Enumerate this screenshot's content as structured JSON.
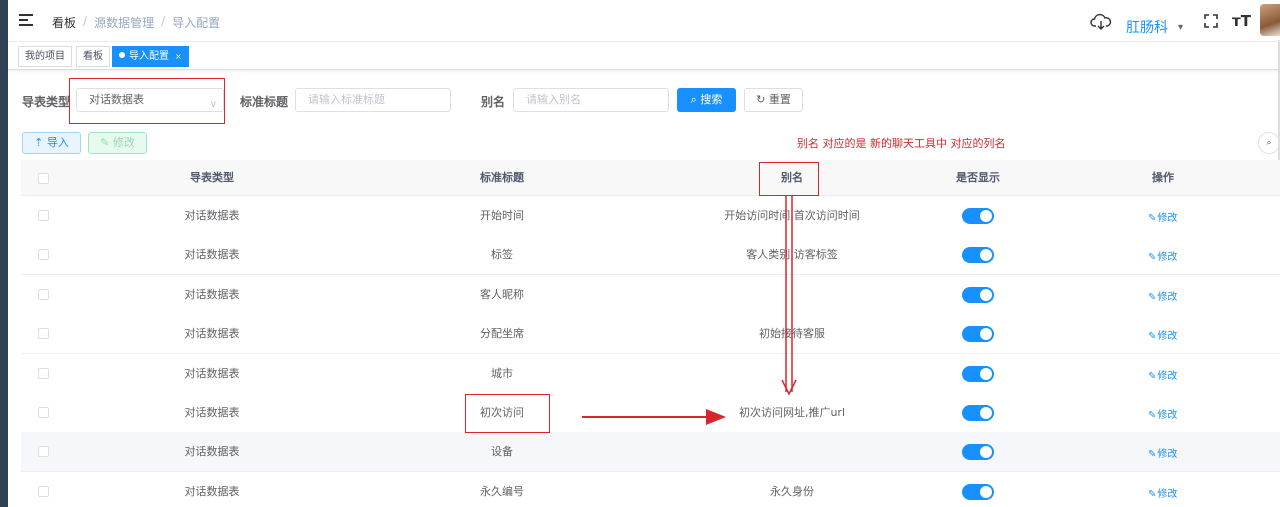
{
  "breadcrumb": {
    "items": [
      "看板",
      "源数据管理",
      "导入配置"
    ],
    "separator": "/"
  },
  "header": {
    "username": "肛肠科",
    "size_icon_text": "тT"
  },
  "tags": [
    {
      "label": "我的项目"
    },
    {
      "label": "看板"
    },
    {
      "label": "导入配置",
      "active": true,
      "close": "×"
    }
  ],
  "search": {
    "type_label": "导表类型",
    "type_value": "对话数据表",
    "title_label": "标准标题",
    "title_placeholder": "请输入标准标题",
    "alias_label": "别名",
    "alias_placeholder": "请输入别名",
    "search_button": "搜索",
    "reset_button": "重置"
  },
  "toolbar": {
    "import_button": "导入",
    "edit_button": "修改"
  },
  "annotation": {
    "note": "别名  对应的是 新的聊天工具中  对应的列名"
  },
  "table": {
    "columns": [
      "导表类型",
      "标准标题",
      "别名",
      "是否显示",
      "操作"
    ],
    "rows": [
      {
        "type": "对话数据表",
        "title": "开始时间",
        "alias": "开始访问时间,首次访问时间",
        "shown": true,
        "action": "修改"
      },
      {
        "type": "对话数据表",
        "title": "标签",
        "alias": "客人类别,访客标签",
        "shown": true,
        "action": "修改"
      },
      {
        "type": "对话数据表",
        "title": "客人昵称",
        "alias": "",
        "shown": true,
        "action": "修改"
      },
      {
        "type": "对话数据表",
        "title": "分配坐席",
        "alias": "初始接待客服",
        "shown": true,
        "action": "修改"
      },
      {
        "type": "对话数据表",
        "title": "城市",
        "alias": "",
        "shown": true,
        "action": "修改"
      },
      {
        "type": "对话数据表",
        "title": "初次访问",
        "alias": "初次访问网址,推广url",
        "shown": true,
        "action": "修改"
      },
      {
        "type": "对话数据表",
        "title": "设备",
        "alias": "",
        "shown": true,
        "action": "修改"
      },
      {
        "type": "对话数据表",
        "title": "永久编号",
        "alias": "永久身份",
        "shown": true,
        "action": "修改"
      }
    ]
  },
  "colors": {
    "primary": "#1890ff",
    "annotation_red": "#d9262e",
    "sidebar_dark": "#304156"
  }
}
